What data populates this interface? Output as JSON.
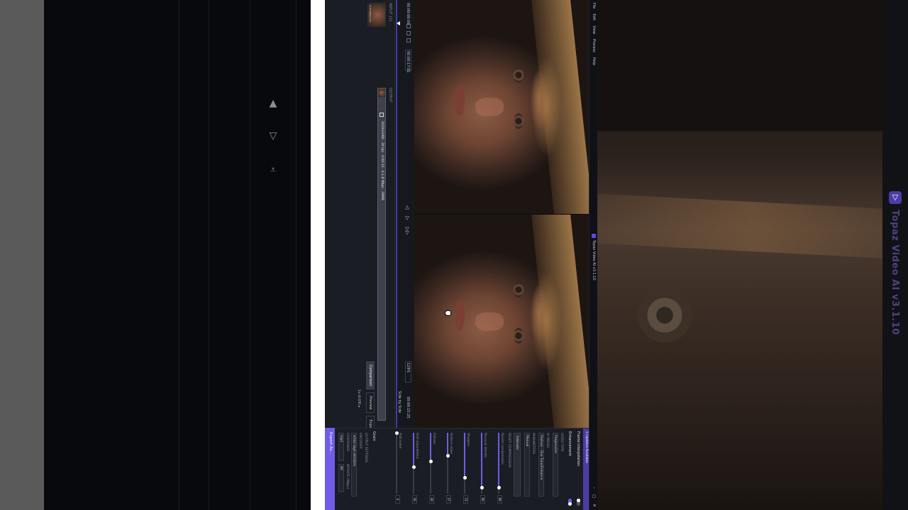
{
  "app": {
    "title": "Topaz Video AI v3.1.10",
    "menu": [
      "File",
      "Edit",
      "View",
      "Process",
      "Help"
    ],
    "window_buttons": [
      "–",
      "◻",
      "✕"
    ]
  },
  "watermark": {
    "text": "Topaz Video AI  v3.1.10"
  },
  "player": {
    "timecode_start": "00:00:00:00",
    "timecode_current": "00:00:17:01",
    "timecode_end": "00:00:15:25",
    "zoom": "129%",
    "compare_label": "Side by Side",
    "buttons": [
      "prev",
      "play",
      "next"
    ]
  },
  "input": {
    "header": "INPUT (1)",
    "thumb_caption": "ILUT Golden_Fox..."
  },
  "output": {
    "header": "OUTPUT",
    "line": "1920x1080 · 30 fps · 0:00:15 · 6-1.8 Mbps · 28MB",
    "subline": "1x (0.Off) ▸",
    "tabs": [
      "Comparison",
      "Preview",
      "Export"
    ],
    "queue_info": "1x (0.Off) ▸"
  },
  "right_panel": {
    "update_banner": "5 Updates Available",
    "frame_interp": "Frame Interpolation",
    "enhancement": "Enhancement",
    "video_type_label": "VIDEO TYPE",
    "video_type": "Progressive",
    "ai_model_label": "AI MODEL",
    "ai_model": "Proteus - Fine Tune/Enhance",
    "parameters_label": "PARAMETERS",
    "parameters": "Manual",
    "estimate_btn": "Estimate",
    "reset_label": "RESET COMPRESSION",
    "sliders": [
      {
        "label": "Revert compression",
        "value": 0.89,
        "display": "89"
      },
      {
        "label": "Recover details",
        "value": 0.9,
        "display": "90"
      },
      {
        "label": "Sharpen",
        "value": 0.73,
        "display": "73"
      },
      {
        "label": "Reduce noise",
        "value": 0.37,
        "display": "37"
      },
      {
        "label": "Dehalo",
        "value": 0.46,
        "display": "46"
      },
      {
        "label": "Anti-alias/deblur",
        "value": 0.56,
        "display": "56"
      },
      {
        "label": "Add noise",
        "value": 0.0,
        "display": "0"
      }
    ],
    "grain_label": "Grain",
    "output_settings": "OUTPUT SETTINGS",
    "encoder_label": "ENCODER",
    "encoder": "H264 High (NVIDIA)",
    "container_label": "CONTAINER",
    "container": "mp4",
    "bitrate_label": "BITRATE (Mbps)",
    "bitrate": "80",
    "audio_label": "AUDIO SETTINGS",
    "audio": "Copy",
    "export_btn": "Export As..."
  },
  "colors": {
    "accent": "#6f5ce8",
    "panel": "#1b1d24",
    "background": "#16181e"
  }
}
